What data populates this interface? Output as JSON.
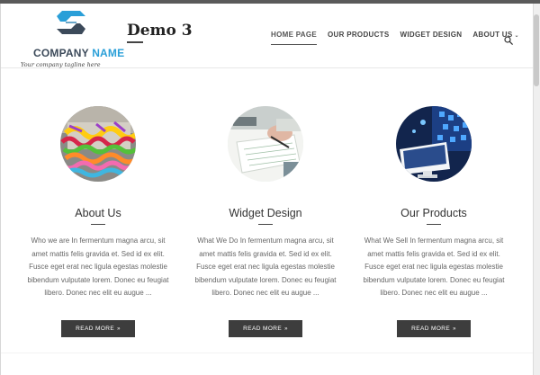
{
  "logo": {
    "company_word": "COMPANY",
    "name_word": "NAME",
    "tagline": "Your company tagline here"
  },
  "site": {
    "title": "Demo 3"
  },
  "nav": {
    "items": [
      {
        "label": "HOME PAGE",
        "active": true
      },
      {
        "label": "OUR PRODUCTS"
      },
      {
        "label": "WIDGET DESIGN"
      },
      {
        "label": "ABOUT US",
        "has_dropdown": true
      }
    ],
    "search_icon": "search-icon"
  },
  "columns": [
    {
      "image": "candy-image",
      "title": "About Us",
      "text": "Who we are In fermentum magna arcu, sit amet mattis felis gravida et. Sed id ex elit. Fusce eget erat nec ligula egestas molestie bibendum vulputate lorem. Donec eu feugiat libero. Donec nec elit eu augue ...",
      "button": "READ MORE"
    },
    {
      "image": "desk-writing-image",
      "title": "Widget Design",
      "text": "What We Do In fermentum magna arcu, sit amet mattis felis gravida et. Sed id ex elit. Fusce eget erat nec ligula egestas molestie bibendum vulputate lorem. Donec eu feugiat libero. Donec nec elit eu augue ...",
      "button": "READ MORE"
    },
    {
      "image": "tech-monitor-image",
      "title": "Our Products",
      "text": "What We Sell In fermentum magna arcu, sit amet mattis felis gravida et. Sed id ex elit. Fusce eget erat nec ligula egestas molestie bibendum vulputate lorem. Donec eu feugiat libero. Donec nec elit eu augue ...",
      "button": "READ MORE"
    }
  ],
  "colors": {
    "accent": "#2a9fd8",
    "button_bg": "#3d3d3d",
    "text": "#666666"
  }
}
